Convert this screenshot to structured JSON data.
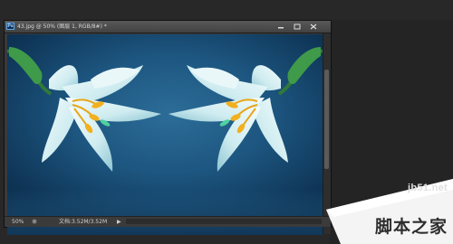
{
  "document": {
    "title": "43.jpg @ 50% (图层 1, RGB/8#) *",
    "app_icon_text": "Ps"
  },
  "statusbar": {
    "zoom": "50%",
    "doc_size": "文档:3.52M/3.52M",
    "arrow": "▶"
  },
  "watermark": {
    "url": "jb51.net",
    "site_name": "脚本之家"
  },
  "colors": {
    "workspace": "#282828",
    "canvas_bg": "#1d5680",
    "petal": "#dff3f6",
    "stamen": "#f2b01e",
    "stem": "#2f7a3a"
  }
}
